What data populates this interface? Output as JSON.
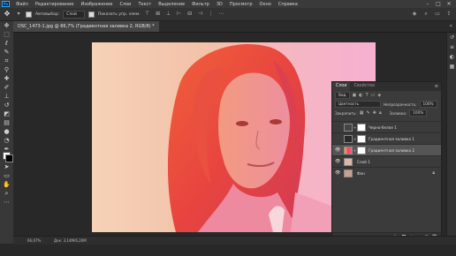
{
  "menubar": {
    "logo": "Ps",
    "items": [
      "Файл",
      "Редактирование",
      "Изображение",
      "Слои",
      "Текст",
      "Выделение",
      "Фильтр",
      "3D",
      "Просмотр",
      "Окно",
      "Справка"
    ],
    "window_controls": [
      "–",
      "□",
      "✕"
    ]
  },
  "options": {
    "autoselect_label": "Автовыбор:",
    "autoselect_value": "Слой",
    "show_controls_label": "Показать упр. элем."
  },
  "document": {
    "tab_title": "DSC_1473-1.jpg @ 66,7% (Градиентная заливка 2, RGB/8) *",
    "collapse": "«"
  },
  "status": {
    "zoom": "66,67%",
    "doc": "Док: 3,14M/6,20M"
  },
  "layers_panel": {
    "tabs": [
      "Слои",
      "Свойства"
    ],
    "filter_value": "Вид",
    "blend_mode": "Цветность",
    "opacity_label": "Непрозрачность:",
    "opacity_value": "100%",
    "lock_label": "Закрепить:",
    "fill_label": "Заливка:",
    "fill_value": "100%",
    "layers": [
      {
        "name": "Черно-белое 1",
        "visible": false,
        "selected": false
      },
      {
        "name": "Градиентная заливка 1",
        "visible": false,
        "selected": false
      },
      {
        "name": "Градиентная заливка 2",
        "visible": true,
        "selected": true
      },
      {
        "name": "Слой 1",
        "visible": true,
        "selected": false
      },
      {
        "name": "Фон",
        "visible": true,
        "selected": false
      }
    ]
  },
  "colors": {
    "foreground": "#ffffff",
    "background": "#000000",
    "gradient": [
      "#f8a070",
      "#f04848",
      "#f060a8"
    ]
  }
}
